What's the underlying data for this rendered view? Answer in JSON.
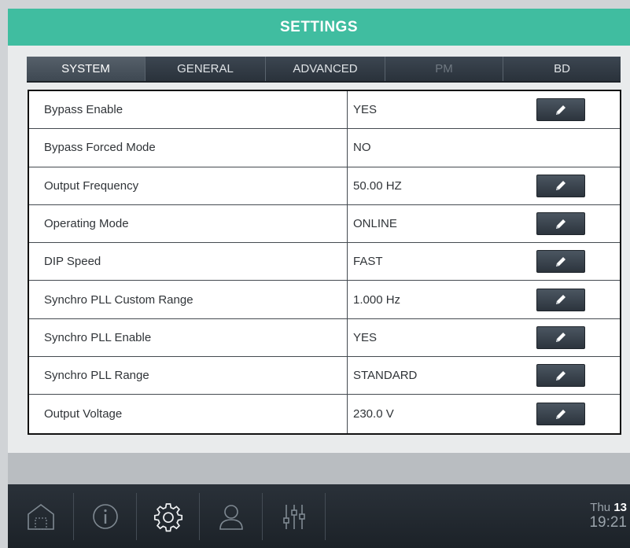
{
  "header": {
    "title": "SETTINGS"
  },
  "tabs": [
    {
      "label": "SYSTEM",
      "state": "active"
    },
    {
      "label": "GENERAL",
      "state": "normal"
    },
    {
      "label": "ADVANCED",
      "state": "normal"
    },
    {
      "label": "PM",
      "state": "disabled"
    },
    {
      "label": "BD",
      "state": "normal"
    }
  ],
  "settings": [
    {
      "label": "Bypass Enable",
      "value": "YES",
      "editable": true
    },
    {
      "label": "Bypass Forced Mode",
      "value": "NO",
      "editable": false
    },
    {
      "label": "Output Frequency",
      "value": "50.00 HZ",
      "editable": true
    },
    {
      "label": "Operating Mode",
      "value": "ONLINE",
      "editable": true
    },
    {
      "label": "DIP Speed",
      "value": "FAST",
      "editable": true
    },
    {
      "label": "Synchro PLL Custom Range",
      "value": "1.000 Hz",
      "editable": true
    },
    {
      "label": "Synchro PLL Enable",
      "value": "YES",
      "editable": true
    },
    {
      "label": "Synchro PLL Range",
      "value": "STANDARD",
      "editable": true
    },
    {
      "label": "Output Voltage",
      "value": "230.0 V",
      "editable": true
    }
  ],
  "edit_icon": "pencil-icon",
  "footer": {
    "nav": [
      {
        "name": "home-icon",
        "active": false
      },
      {
        "name": "info-icon",
        "active": false
      },
      {
        "name": "settings-gear-icon",
        "active": true
      },
      {
        "name": "user-icon",
        "active": false
      },
      {
        "name": "sliders-icon",
        "active": false
      }
    ],
    "clock": {
      "day": "Thu",
      "date": "13",
      "time": "19:21"
    }
  },
  "colors": {
    "header_bg": "#40bda0",
    "tabs_bg": "#2a323b",
    "footer_bg": "#1c2228"
  }
}
